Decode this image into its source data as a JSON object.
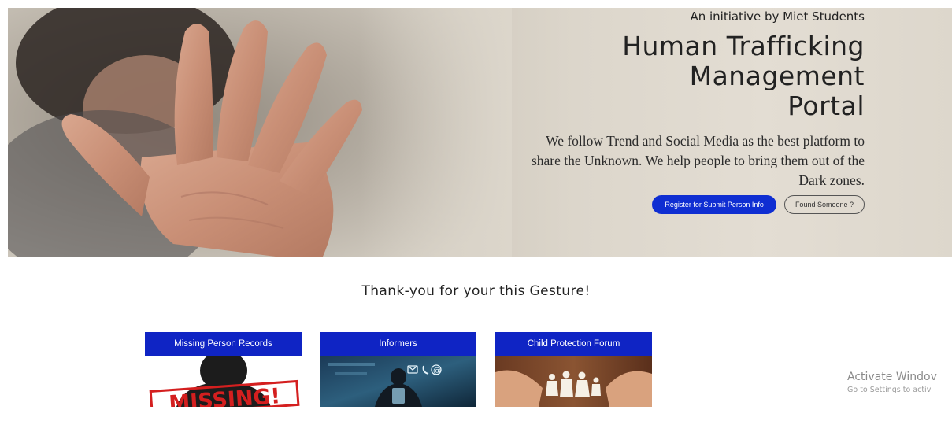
{
  "hero": {
    "eyebrow": "An initiative by Miet Students",
    "title_lines": [
      "Human Trafficking",
      "Management",
      "Portal"
    ],
    "description": "We follow Trend and Social Media as the best platform to share the Unknown. We help people to bring them out of the Dark zones.",
    "primary_button": "Register for Submit Person Info",
    "secondary_button": "Found Someone ?"
  },
  "thanks": "Thank-you for your this Gesture!",
  "cards": [
    {
      "title": "Missing Person Records",
      "image_text": "MISSING!"
    },
    {
      "title": "Informers"
    },
    {
      "title": "Child Protection Forum"
    }
  ],
  "watermark": {
    "title": "Activate Windov",
    "subtitle": "Go to Settings to activ"
  },
  "colors": {
    "primary_blue": "#0f2ed2",
    "card_header_blue": "#0f24c4"
  }
}
